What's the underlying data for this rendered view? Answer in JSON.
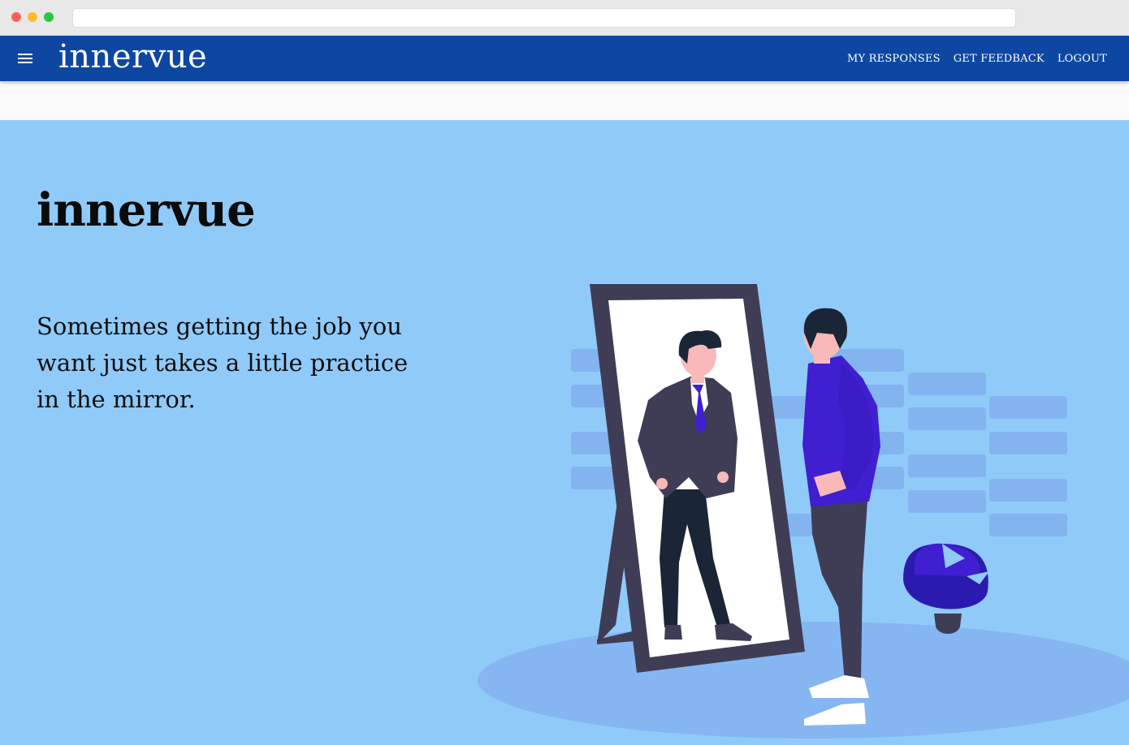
{
  "app": {
    "brand": "innervue"
  },
  "nav": {
    "links": [
      {
        "label": "MY RESPONSES"
      },
      {
        "label": "GET FEEDBACK"
      },
      {
        "label": "LOGOUT"
      }
    ]
  },
  "hero": {
    "title": "innervue",
    "tagline": "Sometimes getting the job you want just takes a little practice in the mirror."
  },
  "colors": {
    "app_bar": "#0d47a1",
    "hero_background": "#90caf9",
    "accent_purple": "#3f1fd0"
  },
  "icons": {
    "menu": "hamburger-menu-icon"
  }
}
